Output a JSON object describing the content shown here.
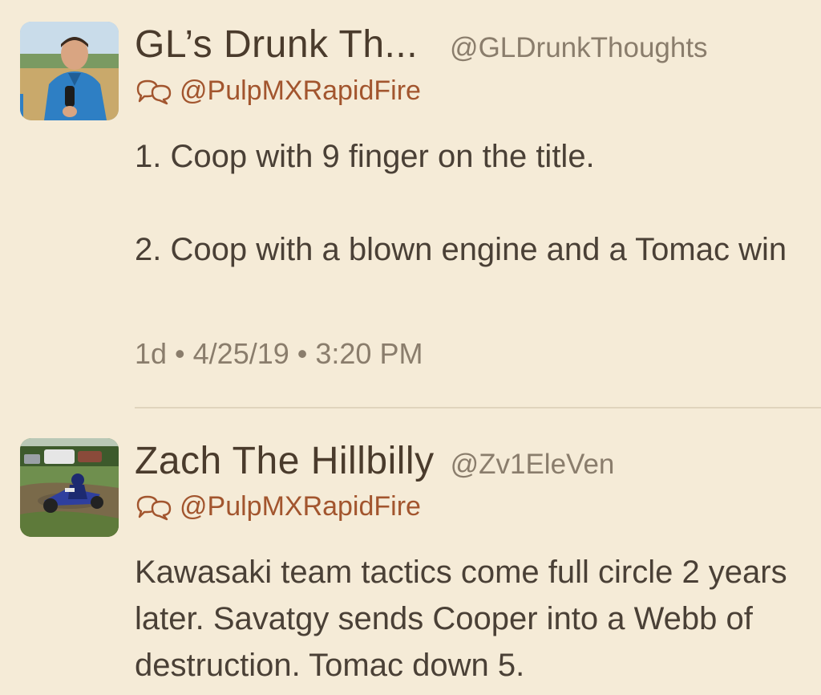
{
  "tweets": [
    {
      "display_name": "GL’s Drunk Th...",
      "handle": "@GLDrunkThoughts",
      "reply_to": "@PulpMXRapidFire",
      "text": "1. Coop with 9 finger on the title.\n\n2. Coop with a blown engine and a Tomac win",
      "timestamp": "1d • 4/25/19 • 3:20 PM",
      "avatar_icon": "person-with-microphone-photo"
    },
    {
      "display_name": "Zach The Hillbilly",
      "handle": "@Zv1EleVen",
      "reply_to": "@PulpMXRapidFire",
      "text": "Kawasaki team tactics come full circle 2 years later. Savatgy sends Cooper into a Webb of destruction. Tomac down 5.",
      "avatar_icon": "motocross-rider-photo"
    }
  ],
  "colors": {
    "background": "#f5ebd7",
    "text": "#4a4036",
    "secondary": "#8a7d6c",
    "accent": "#a2552e",
    "separator": "#e0d4bd"
  },
  "icons": {
    "reply_icon": "conversation-bubbles-icon"
  }
}
